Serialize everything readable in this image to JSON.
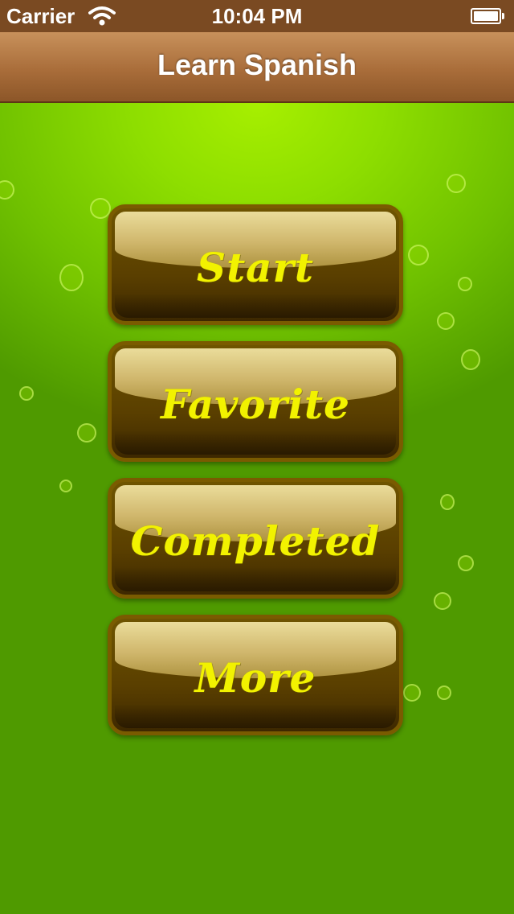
{
  "status_bar": {
    "carrier": "Carrier",
    "time": "10:04 PM",
    "wifi_icon": "wifi-icon",
    "battery_icon": "battery-icon"
  },
  "nav_bar": {
    "title": "Learn Spanish"
  },
  "menu": {
    "buttons": [
      {
        "label": "Start"
      },
      {
        "label": "Favorite"
      },
      {
        "label": "Completed"
      },
      {
        "label": "More"
      }
    ]
  },
  "colors": {
    "nav_bar": "#a96d3a",
    "background": "#8ede00",
    "button_fill": "#5a3f00",
    "button_text": "#f2f200"
  }
}
